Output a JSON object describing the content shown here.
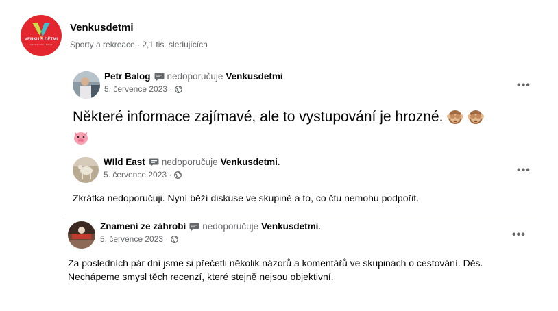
{
  "page": {
    "name": "Venkusdetmi",
    "meta": "Sporty a rekreace · 2,1 tis. sledujících",
    "logo_text": "VENKU S DĚTMI",
    "logo_sub": "zajímavá místa v Evropě"
  },
  "reviews": [
    {
      "author": "Petr Balog",
      "verb": "nedoporučuje",
      "target": "Venkusdetmi",
      "date": "5. července 2023 ·",
      "text": "Některé informace zajímavé, ale to vystupování je hrozné.",
      "emojis": [
        "see-no-evil-monkey",
        "see-no-evil-monkey",
        "pig-face"
      ],
      "more": "•••"
    },
    {
      "author": "WIld East",
      "verb": "nedoporučuje",
      "target": "Venkusdetmi",
      "date": "5. července 2023 ·",
      "text": "Zkrátka nedoporučuji. Nyní běží diskuse ve skupině a to, co čtu nemohu podpořit.",
      "more": "•••"
    },
    {
      "author": "Znamení ze záhrobí",
      "verb": "nedoporučuje",
      "target": "Venkusdetmi",
      "date": "5. července 2023 ·",
      "text_line1": "Za posledních pár dní jsme si přečetli několik názorů a komentářů ve skupinách o cestování. Děs.",
      "text_line2": "Nechápeme smysl těch recenzí, které stejně nejsou objektivní.",
      "more": "•••"
    }
  ],
  "colors": {
    "brand_red": "#e4272f",
    "text_secondary": "#65676b",
    "divider": "#dadde1"
  }
}
